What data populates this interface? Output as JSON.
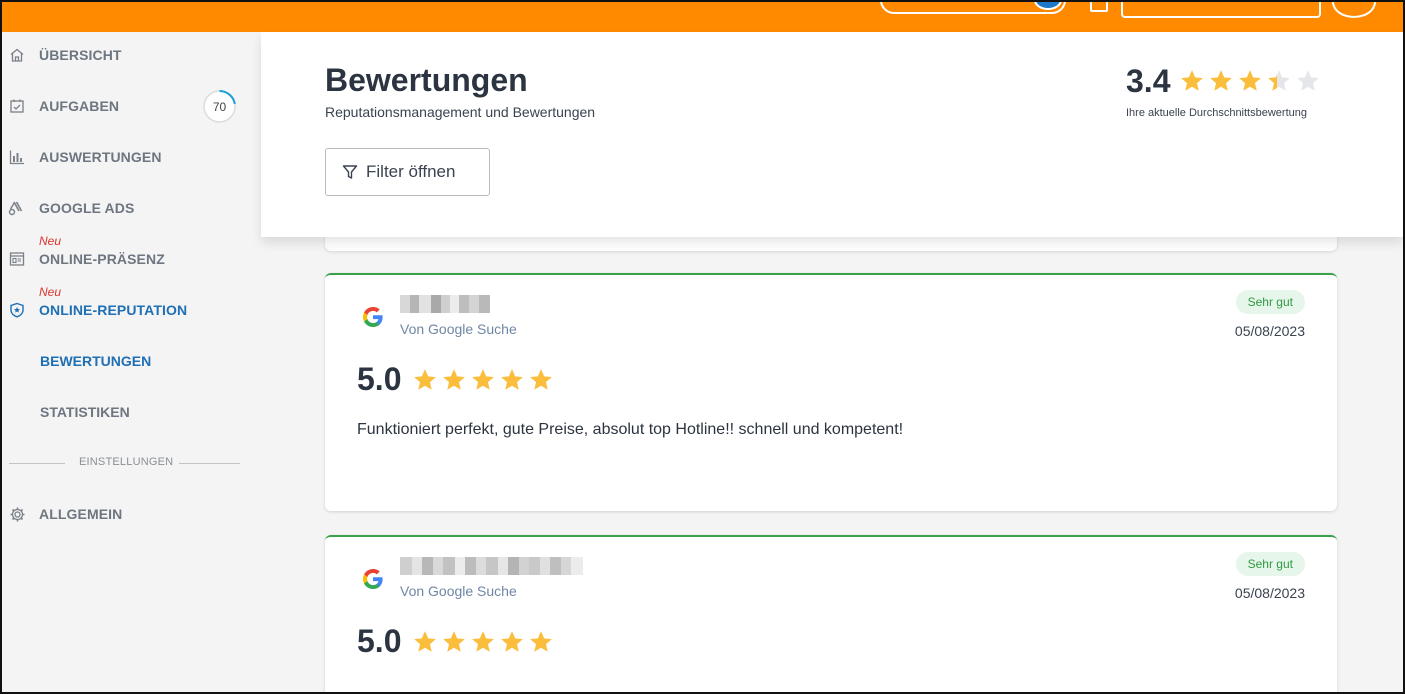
{
  "topbar": {
    "brand": "",
    "brand_sub": "",
    "accent_color": "#ff8a00"
  },
  "sidebar": {
    "items": [
      {
        "label": "ÜBERSICHT",
        "icon": "home-icon"
      },
      {
        "label": "AUFGABEN",
        "icon": "checklist-icon",
        "progress": "70"
      },
      {
        "label": "AUSWERTUNGEN",
        "icon": "bar-chart-icon"
      },
      {
        "label": "GOOGLE ADS",
        "icon": "google-ads-icon"
      },
      {
        "label": "ONLINE-PRÄSENZ",
        "icon": "browser-icon",
        "badge": "Neu"
      },
      {
        "label": "ONLINE-REPUTATION",
        "icon": "shield-star-icon",
        "badge": "Neu",
        "active": true
      }
    ],
    "sub_items": [
      {
        "label": "BEWERTUNGEN",
        "active": true
      },
      {
        "label": "STATISTIKEN"
      }
    ],
    "section_label": "EINSTELLUNGEN",
    "settings_items": [
      {
        "label": "ALLGEMEIN",
        "icon": "gear-icon"
      }
    ]
  },
  "header": {
    "title": "Bewertungen",
    "subtitle": "Reputationsmanagement und Bewertungen",
    "filter_label": "Filter öffnen",
    "avg_score": "3.4",
    "avg_rating": 3.4,
    "avg_caption": "Ihre aktuelle Durchschnittsbewertung"
  },
  "reviews": [
    {
      "source": "Von Google Suche",
      "badge": "Sehr gut",
      "date": "05/08/2023",
      "score": "5.0",
      "rating": 5,
      "text": "Funktioniert perfekt, gute Preise, absolut top Hotline!! schnell und kompetent!"
    },
    {
      "source": "Von Google Suche",
      "badge": "Sehr gut",
      "date": "05/08/2023",
      "score": "5.0",
      "rating": 5,
      "text": ""
    }
  ],
  "colors": {
    "star": "#fbbd3c",
    "star_empty": "#e4e6ea",
    "active": "#1f6fb4",
    "positive_border": "#3aa14a"
  }
}
